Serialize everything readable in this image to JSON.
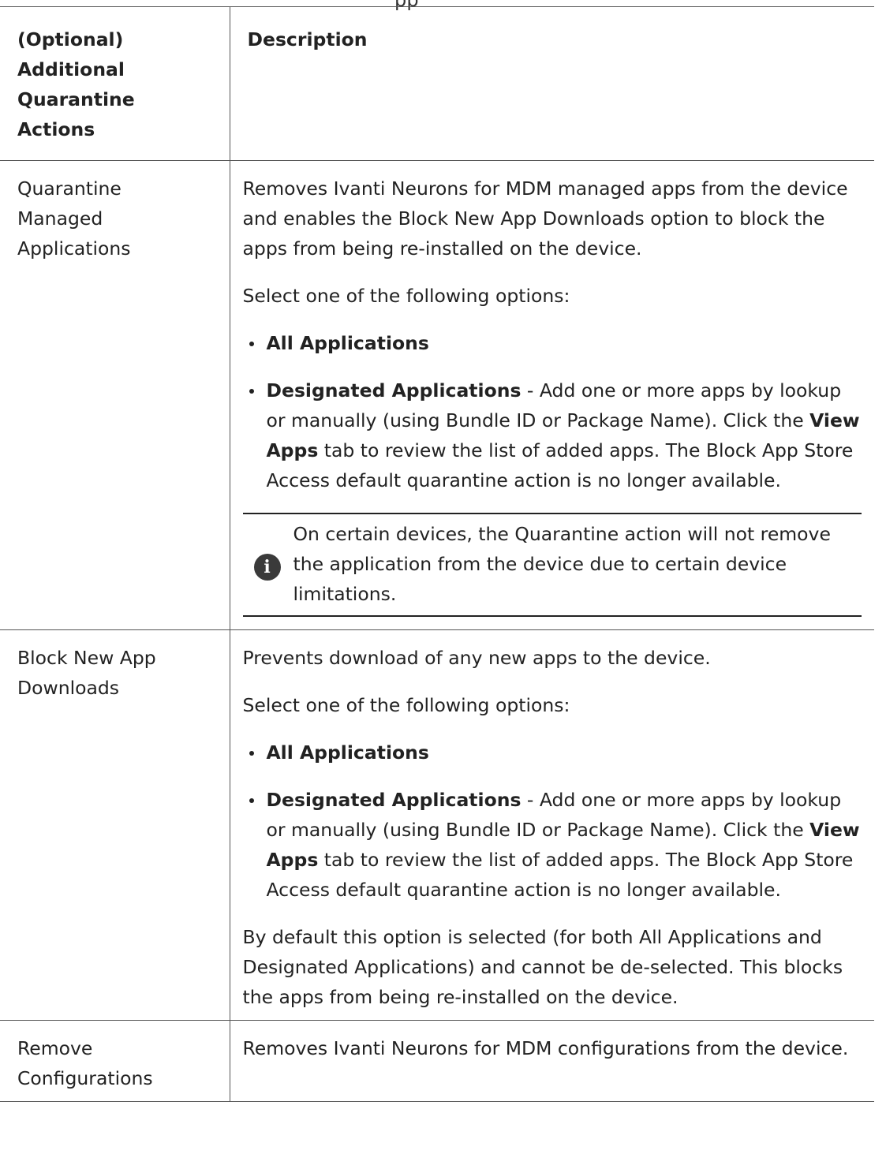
{
  "header_fragment": "pp",
  "table": {
    "header": {
      "col1_line1": "(Optional)",
      "col1_line2": "Additional",
      "col1_line3": "Quarantine Actions",
      "col2": "Description"
    },
    "rows": [
      {
        "action_lines": [
          "Quarantine",
          "Managed",
          "Applications"
        ],
        "intro": "Removes Ivanti Neurons for MDM managed apps from the device and enables the Block New App Downloads option to block the apps from being re-installed on the device.",
        "select_text": "Select one of the following options:",
        "option_all": "All Applications",
        "option_designated_bold": "Designated Applications",
        "option_designated_text1": " - Add one or more apps by lookup or manually (using Bundle ID or Package Name). Click the ",
        "option_designated_view": "View Apps",
        "option_designated_text2": " tab to review the list of added apps. The Block App Store Access default quarantine action is no longer available.",
        "note": "On certain devices, the Quarantine action will not remove the application from the device due to certain device limitations."
      },
      {
        "action_lines": [
          "Block New App",
          "Downloads"
        ],
        "intro": "Prevents download of any new apps to the device.",
        "select_text": "Select one of the following options:",
        "option_all": "All Applications",
        "option_designated_bold": "Designated Applications",
        "option_designated_text1": " - Add one or more apps by lookup or manually (using Bundle ID or Package Name). Click the ",
        "option_designated_view": "View Apps",
        "option_designated_text2": " tab to review the list of added apps. The Block App Store Access default quarantine action is no longer available.",
        "footer": "By default this option is selected (for both All Applications and Designated Applications) and cannot be de-selected. This blocks the apps from being re-installed on the device."
      },
      {
        "action_lines": [
          "Remove",
          "Configurations"
        ],
        "intro": "Removes Ivanti Neurons for MDM configurations from the device."
      }
    ]
  },
  "icons": {
    "note": "info-icon"
  }
}
